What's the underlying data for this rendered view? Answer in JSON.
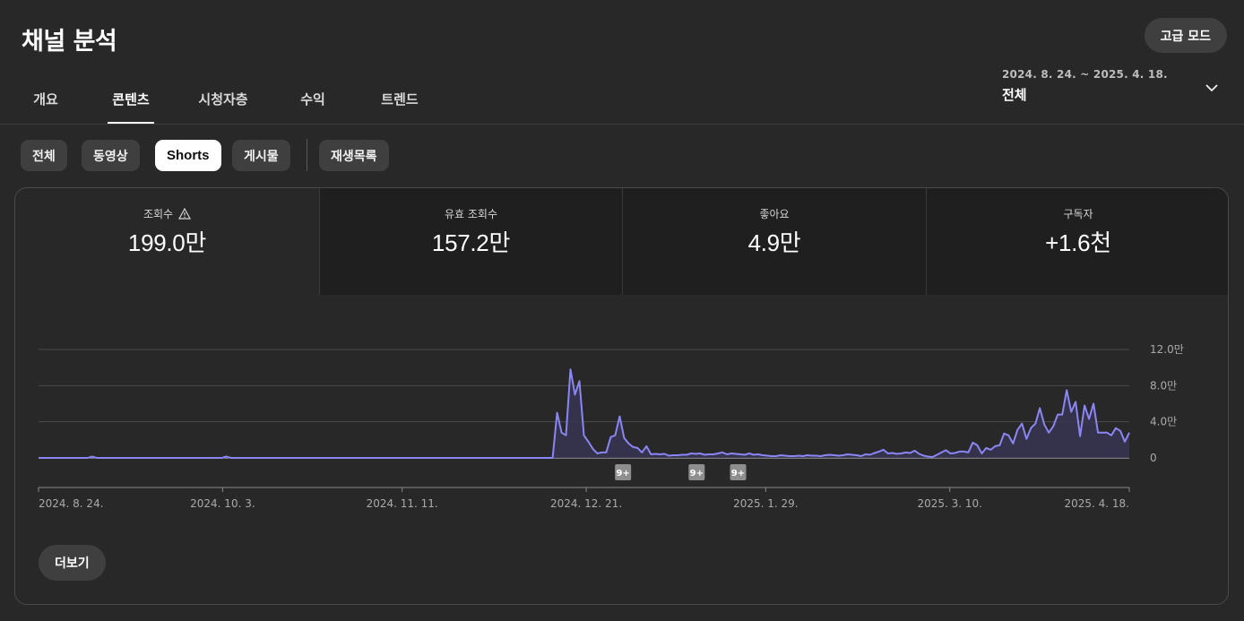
{
  "header": {
    "title": "채널 분석",
    "advanced_mode_label": "고급 모드"
  },
  "tabs": [
    {
      "label": "개요",
      "active": false
    },
    {
      "label": "콘텐츠",
      "active": true
    },
    {
      "label": "시청자층",
      "active": false
    },
    {
      "label": "수익",
      "active": false
    },
    {
      "label": "트렌드",
      "active": false
    }
  ],
  "date_picker": {
    "range": "2024. 8. 24. ~ 2025. 4. 18.",
    "selected": "전체",
    "icon": "chevron-down-icon"
  },
  "content_filters": [
    {
      "label": "전체",
      "active": false
    },
    {
      "label": "동영상",
      "active": false
    },
    {
      "label": "Shorts",
      "active": true
    },
    {
      "label": "게시물",
      "active": false
    },
    {
      "label": "재생목록",
      "active": false
    }
  ],
  "metrics": [
    {
      "label": "조회수",
      "value": "199.0만",
      "icon": "warning-icon",
      "active": true
    },
    {
      "label": "유효 조회수",
      "value": "157.2만",
      "active": false
    },
    {
      "label": "좋아요",
      "value": "4.9만",
      "active": false
    },
    {
      "label": "구독자",
      "value": "+1.6천",
      "active": false
    }
  ],
  "more_button_label": "더보기",
  "colors": {
    "background": "#282828",
    "line": "#8b86f4",
    "area": "#373551",
    "grid": "#4a4a4a"
  },
  "chart_data": {
    "type": "area",
    "series_metric": "조회수",
    "x_start": "2024. 8. 24.",
    "x_end": "2025. 4. 18.",
    "x_ticks": [
      "2024. 8. 24.",
      "2024. 10. 3.",
      "2024. 11. 11.",
      "2024. 12. 21.",
      "2025. 1. 29.",
      "2025. 3. 10.",
      "2025. 4. 18."
    ],
    "y_ticks": [
      "12.0만",
      "8.0만",
      "4.0만",
      "0"
    ],
    "ylim": [
      0,
      120000
    ],
    "grid": true,
    "annotations": [
      {
        "label": "9+",
        "date": "2024. 12. 29."
      },
      {
        "label": "9+",
        "date": "2025. 1. 14."
      },
      {
        "label": "9+",
        "date": "2025. 1. 23."
      }
    ],
    "daily_views": [
      0,
      0,
      0,
      0,
      0,
      0,
      0,
      0,
      0,
      0,
      0,
      0,
      1500,
      0,
      0,
      0,
      0,
      0,
      0,
      0,
      0,
      0,
      0,
      0,
      0,
      0,
      0,
      0,
      0,
      0,
      0,
      0,
      0,
      0,
      0,
      0,
      0,
      0,
      0,
      0,
      0,
      0,
      1500,
      0,
      0,
      0,
      0,
      0,
      0,
      0,
      0,
      0,
      0,
      0,
      0,
      0,
      0,
      0,
      0,
      0,
      0,
      0,
      0,
      0,
      0,
      0,
      0,
      0,
      0,
      0,
      0,
      0,
      0,
      0,
      0,
      0,
      0,
      0,
      0,
      0,
      0,
      0,
      0,
      0,
      0,
      0,
      0,
      0,
      0,
      0,
      0,
      0,
      0,
      0,
      0,
      0,
      0,
      0,
      0,
      0,
      0,
      0,
      0,
      0,
      0,
      0,
      0,
      0,
      0,
      0,
      0,
      0,
      0,
      0,
      0,
      0,
      50000,
      28000,
      25000,
      98000,
      70000,
      85000,
      25000,
      18000,
      10000,
      5000,
      6000,
      6000,
      23000,
      25000,
      46000,
      22000,
      16000,
      12000,
      11000,
      6000,
      13000,
      4000,
      4500,
      4000,
      4500,
      2500,
      3000,
      3000,
      3500,
      3500,
      5000,
      4500,
      5000,
      3500,
      4000,
      4000,
      5000,
      6000,
      4000,
      5000,
      4500,
      4000,
      3500,
      5000,
      3500,
      4000,
      3000,
      2500,
      2000,
      2000,
      3000,
      2500,
      2000,
      2000,
      2500,
      2000,
      3000,
      2500,
      2500,
      2000,
      3000,
      3500,
      3000,
      2500,
      3000,
      4000,
      3500,
      3000,
      2000,
      4000,
      3500,
      5500,
      7000,
      9000,
      5000,
      5500,
      4500,
      5000,
      6000,
      5500,
      8000,
      4500,
      2500,
      1500,
      1000,
      3500,
      6000,
      8500,
      5000,
      5500,
      7000,
      7000,
      6000,
      17000,
      14000,
      5000,
      11000,
      9000,
      13000,
      14000,
      27000,
      25000,
      16000,
      31000,
      38000,
      21000,
      33000,
      38000,
      55000,
      37000,
      28000,
      35000,
      48000,
      48000,
      75000,
      51000,
      62000,
      24000,
      58000,
      43000,
      60000,
      28000,
      28000,
      28000,
      25000,
      33000,
      30000,
      18000,
      28000
    ]
  }
}
